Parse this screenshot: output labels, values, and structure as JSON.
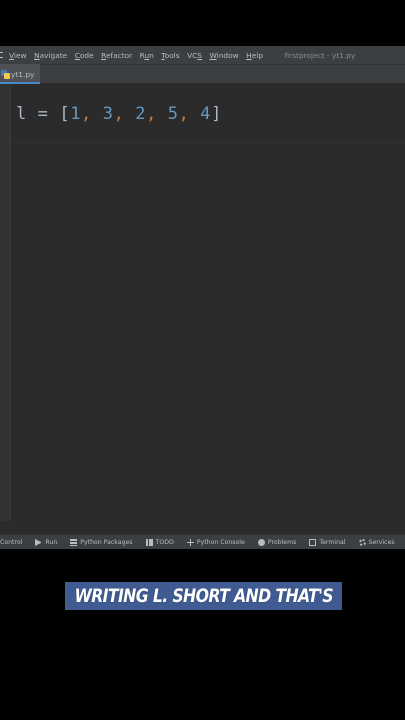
{
  "menu": {
    "items": [
      "View",
      "Navigate",
      "Code",
      "Refactor",
      "Run",
      "Tools",
      "VCS",
      "Window",
      "Help"
    ],
    "underline": [
      "V",
      "N",
      "C",
      "R",
      "u",
      "T",
      "S",
      "W",
      "H"
    ],
    "window_title": "firstproject - yt1.py"
  },
  "tabs": [
    {
      "label": "yt1.py",
      "icon": "python-file-icon",
      "active": true
    }
  ],
  "editor": {
    "code_line_1": {
      "var": "l",
      "op": " = ",
      "open": "[",
      "numbers": [
        "1",
        "3",
        "2",
        "5",
        "4"
      ],
      "sep": ", ",
      "close": "]"
    }
  },
  "tool_windows": [
    {
      "label": "Control",
      "icon": ""
    },
    {
      "label": "Run",
      "icon": "run-icon"
    },
    {
      "label": "Python Packages",
      "icon": "layers-icon"
    },
    {
      "label": "TODO",
      "icon": "list-icon"
    },
    {
      "label": "Python Console",
      "icon": "console-icon"
    },
    {
      "label": "Problems",
      "icon": "info-icon"
    },
    {
      "label": "Terminal",
      "icon": "terminal-icon"
    },
    {
      "label": "Services",
      "icon": "gear-icon"
    }
  ],
  "caption": {
    "text": "WRITING L. SHORT AND THAT'S"
  },
  "colors": {
    "editor_bg": "#2b2b2b",
    "number": "#6897bb",
    "comma": "#cc7832",
    "caption_bg": "#3f5b92"
  }
}
